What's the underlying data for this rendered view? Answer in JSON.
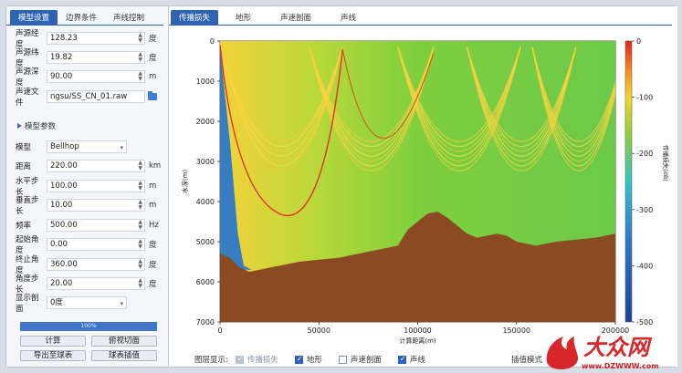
{
  "left_panel": {
    "tabs": [
      "模型设置",
      "边界条件",
      "声线控制"
    ],
    "fields_top": [
      {
        "label": "声源经度",
        "value": "128.23",
        "unit": "度"
      },
      {
        "label": "声源纬度",
        "value": "19.82",
        "unit": "度"
      },
      {
        "label": "声源深度",
        "value": "90.00",
        "unit": "m"
      },
      {
        "label": "声速文件",
        "value": "ngsu/SS_CN_01.raw",
        "unit": ""
      }
    ],
    "section_title": "模型参数",
    "fields_model": [
      {
        "label": "模型",
        "value": "Bellhop",
        "unit": ""
      },
      {
        "label": "距离",
        "value": "220.00",
        "unit": "km"
      },
      {
        "label": "水平步长",
        "value": "100.00",
        "unit": "m"
      },
      {
        "label": "垂直步长",
        "value": "10.00",
        "unit": "m"
      },
      {
        "label": "频率",
        "value": "500.00",
        "unit": "Hz"
      },
      {
        "label": "起始角度",
        "value": "0.00",
        "unit": "度"
      },
      {
        "label": "终止角度",
        "value": "360.00",
        "unit": "度"
      },
      {
        "label": "角度步长",
        "value": "20.00",
        "unit": "度"
      },
      {
        "label": "显示剖面",
        "value": "0度",
        "unit": ""
      }
    ],
    "progress": {
      "value": 1.0,
      "label": "100%"
    },
    "buttons": [
      "计算",
      "俯视切面",
      "导出至球表",
      "球表插值"
    ]
  },
  "right_panel": {
    "tabs": [
      "传播损失",
      "地形",
      "声速剖面",
      "声线"
    ],
    "layers_label": "图层显示:",
    "layers": [
      {
        "label": "传播损失",
        "checked": true,
        "disabled": true
      },
      {
        "label": "地形",
        "checked": true,
        "disabled": false
      },
      {
        "label": "声速剖面",
        "checked": false,
        "disabled": false
      },
      {
        "label": "声线",
        "checked": true,
        "disabled": false
      }
    ],
    "interp_label": "插值模式"
  },
  "chart_data": {
    "type": "heatmap",
    "xlabel": "计算距离(m)",
    "ylabel": "水深(m)",
    "xlim": [
      0,
      200000
    ],
    "ylim": [
      0,
      7000
    ],
    "x_ticks": [
      "0",
      "50000",
      "100000",
      "150000",
      "200000"
    ],
    "y_ticks": [
      "0",
      "1000",
      "2000",
      "3000",
      "4000",
      "5000",
      "6000",
      "7000"
    ],
    "colorbar": {
      "label": "传播损失(dB)",
      "range": [
        -500,
        0
      ],
      "ticks": [
        "0",
        "-100",
        "-200",
        "-300",
        "-400",
        "-500"
      ],
      "colors": [
        "#e8211a",
        "#f7d22a",
        "#8fd136",
        "#39c2c6",
        "#2c73c9",
        "#1d3fa0"
      ]
    },
    "bottom_depth_profile": {
      "x": [
        0,
        5000,
        10000,
        15000,
        20000,
        30000,
        40000,
        50000,
        60000,
        70000,
        80000,
        90000,
        95000,
        100000,
        105000,
        110000,
        115000,
        120000,
        125000,
        130000,
        140000,
        145000,
        150000,
        160000,
        170000,
        180000,
        190000,
        200000
      ],
      "depth": [
        5300,
        5400,
        5650,
        5750,
        5700,
        5600,
        5500,
        5450,
        5400,
        5300,
        5200,
        5100,
        4700,
        4500,
        4300,
        4250,
        4400,
        4600,
        4800,
        4900,
        4800,
        4850,
        5000,
        5100,
        5000,
        4950,
        4900,
        4800
      ]
    }
  },
  "watermark": {
    "text": "大众网",
    "url": "www.DZWWW.com"
  }
}
